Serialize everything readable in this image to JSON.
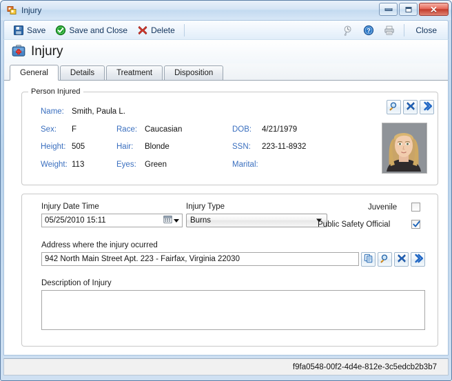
{
  "window": {
    "title": "Injury",
    "icon": "form-icon",
    "controls": {
      "minimize": "minimize-button",
      "maximize": "maximize-button",
      "close": "✕"
    }
  },
  "toolbar": {
    "save_label": "Save",
    "save_and_close_label": "Save and Close",
    "delete_label": "Delete",
    "history_icon": "clock-history-icon",
    "help_icon": "help-icon",
    "print_icon": "printer-icon",
    "close_label": "Close"
  },
  "page": {
    "title": "Injury",
    "icon": "first-aid-kit-icon"
  },
  "tabs": [
    {
      "label": "General",
      "active": true
    },
    {
      "label": "Details",
      "active": false
    },
    {
      "label": "Treatment",
      "active": false
    },
    {
      "label": "Disposition",
      "active": false
    }
  ],
  "person_injured": {
    "group_title": "Person Injured",
    "fields": {
      "name_label": "Name:",
      "name_value": "Smith, Paula L.",
      "sex_label": "Sex:",
      "sex_value": "F",
      "race_label": "Race:",
      "race_value": "Caucasian",
      "dob_label": "DOB:",
      "dob_value": "4/21/1979",
      "height_label": "Height:",
      "height_value": "505",
      "hair_label": "Hair:",
      "hair_value": "Blonde",
      "ssn_label": "SSN:",
      "ssn_value": "223-11-8932",
      "weight_label": "Weight:",
      "weight_value": "113",
      "eyes_label": "Eyes:",
      "eyes_value": "Green",
      "marital_label": "Marital:",
      "marital_value": ""
    },
    "actions": {
      "search": "search-icon",
      "clear": "clear-x-icon",
      "go": "go-chevron-icon"
    },
    "photo_alt": "person-photo"
  },
  "injury_details": {
    "date_time_label": "Injury Date Time",
    "date_time_value": "05/25/2010 15:11",
    "date_picker_icon": "calendar-icon",
    "injury_type_label": "Injury Type",
    "injury_type_value": "Burns",
    "juvenile_label": "Juvenile",
    "juvenile_checked": false,
    "public_safety_label": "Public Safety Official",
    "public_safety_checked": true,
    "address_label": "Address where the injury ocurred",
    "address_value": "942 North Main Street Apt. 223 - Fairfax, Virginia 22030",
    "address_actions": {
      "copy": "copy-icon",
      "search": "search-icon",
      "clear": "clear-x-icon",
      "go": "go-chevron-icon"
    },
    "description_label": "Description of Injury",
    "description_value": ""
  },
  "status": {
    "record_id": "f9fa0548-00f2-4d4e-812e-3c5edcb2b3b7"
  },
  "colors": {
    "label_blue": "#3a6fbf",
    "accent_blue": "#1f5fbf",
    "close_red": "#c23b2b",
    "check_green": "#1d9f28"
  }
}
